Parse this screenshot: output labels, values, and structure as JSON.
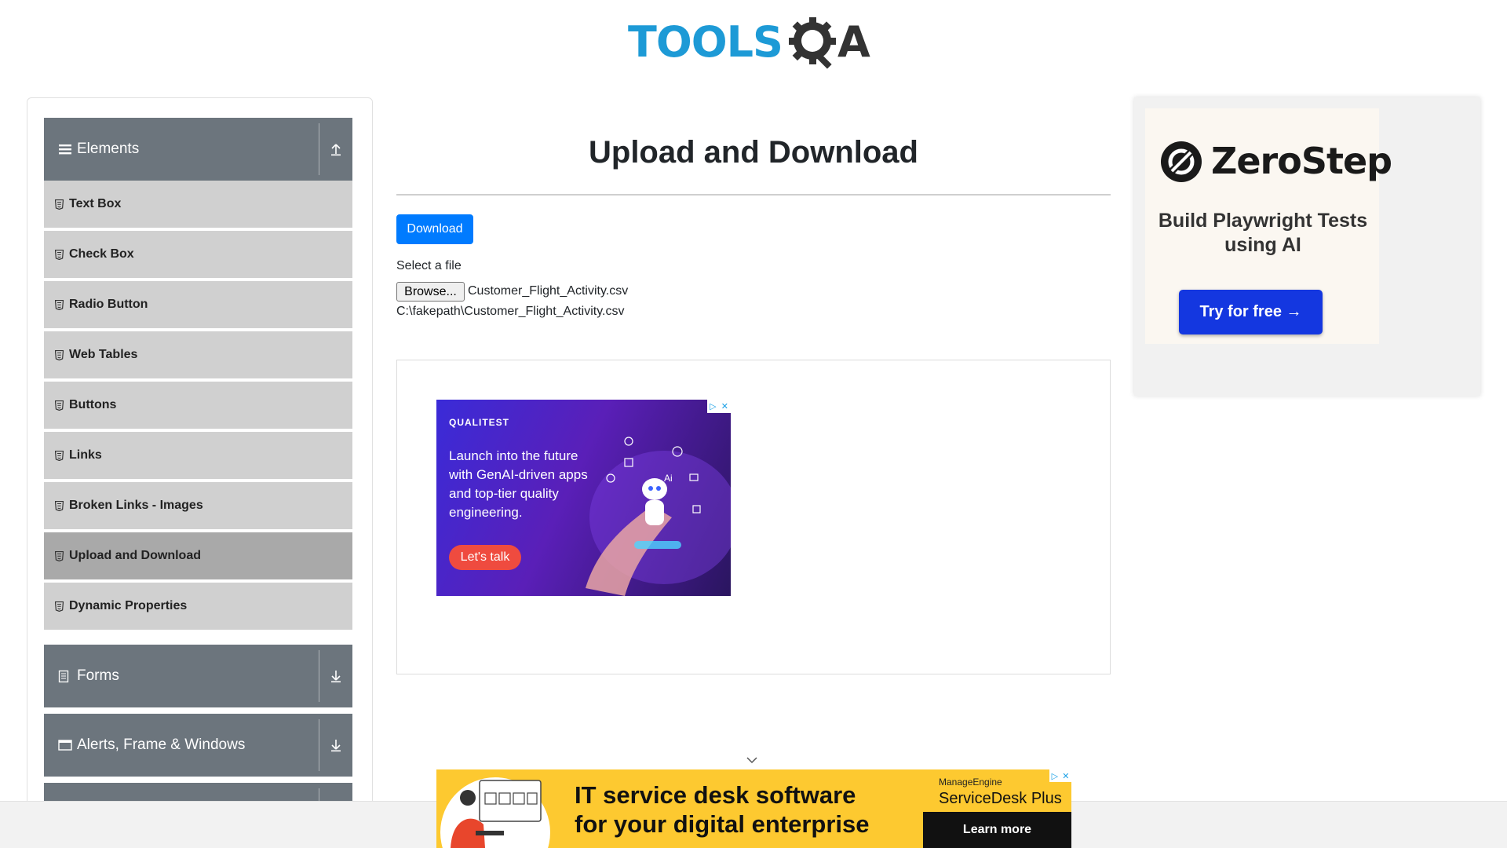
{
  "header": {
    "logo_part1": "TOOLS",
    "logo_part2": "A"
  },
  "sidebar": {
    "elements_group": {
      "label": "Elements",
      "items": [
        {
          "label": "Text Box",
          "active": false
        },
        {
          "label": "Check Box",
          "active": false
        },
        {
          "label": "Radio Button",
          "active": false
        },
        {
          "label": "Web Tables",
          "active": false
        },
        {
          "label": "Buttons",
          "active": false
        },
        {
          "label": "Links",
          "active": false
        },
        {
          "label": "Broken Links - Images",
          "active": false
        },
        {
          "label": "Upload and Download",
          "active": true
        },
        {
          "label": "Dynamic Properties",
          "active": false
        }
      ]
    },
    "forms_group": {
      "label": "Forms"
    },
    "alerts_group": {
      "label": "Alerts, Frame & Windows"
    }
  },
  "main": {
    "title": "Upload and Download",
    "download_label": "Download",
    "select_label": "Select a file",
    "browse_label": "Browse...",
    "file_name": "Customer_Flight_Activity.csv",
    "uploaded_path": "C:\\fakepath\\Customer_Flight_Activity.csv"
  },
  "ads": {
    "qualitest": {
      "brand": "QUALITEST",
      "headline": "Launch into the future with GenAI-driven apps and top-tier quality engineering.",
      "cta": "Let's talk"
    },
    "zerostep": {
      "name": "ZeroStep",
      "tagline": "Build Playwright Tests using AI",
      "cta": "Try for free →"
    },
    "servicedesk": {
      "headline_line1": "IT service desk software",
      "headline_line2": "for your digital enterprise",
      "vendor": "ManageEngine",
      "product": "ServiceDesk Plus",
      "cta": "Learn more"
    }
  },
  "colors": {
    "accent": "#007bff",
    "group_header": "#6c757d",
    "menu_item": "#d0d0d0",
    "menu_item_active": "#a9a9a9"
  }
}
